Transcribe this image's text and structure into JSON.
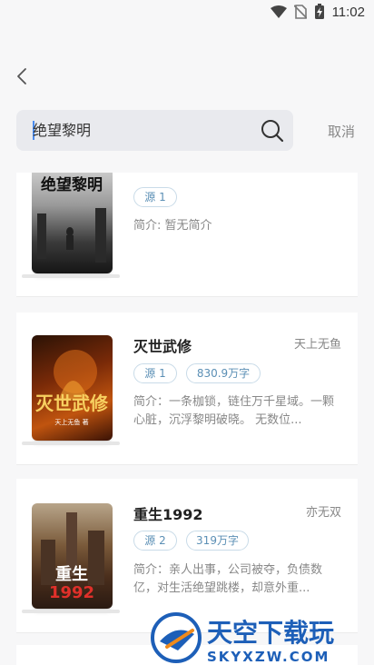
{
  "status": {
    "time": "11:02"
  },
  "search": {
    "query": "绝望黎明",
    "cancel_label": "取消"
  },
  "colors": {
    "accent": "#4a8cf0",
    "tag_text": "#5b8fb5",
    "tag_border": "#c9dbe8"
  },
  "results": [
    {
      "title": "",
      "author": "",
      "source": "源 1",
      "wordcount": "",
      "desc": "简介: 暂无简介",
      "cover_text": "绝望黎明"
    },
    {
      "title": "灭世武修",
      "author": "天上无鱼",
      "source": "源 1",
      "wordcount": "830.9万字",
      "desc": "简介：一条枷锁，链住万千星域。一颗心脏，沉浮黎明破晓。 无数位...",
      "cover_text": "灭世武修"
    },
    {
      "title": "重生1992",
      "author": "亦无双",
      "source": "源 2",
      "wordcount": "319万字",
      "desc": "简介：亲人出事，公司被夺，负债数亿，对生活绝望跳楼，却意外重...",
      "cover_text": "重生1992"
    }
  ],
  "watermark": {
    "brand": "天空下载玩",
    "url": "SKYXZW.COM"
  }
}
